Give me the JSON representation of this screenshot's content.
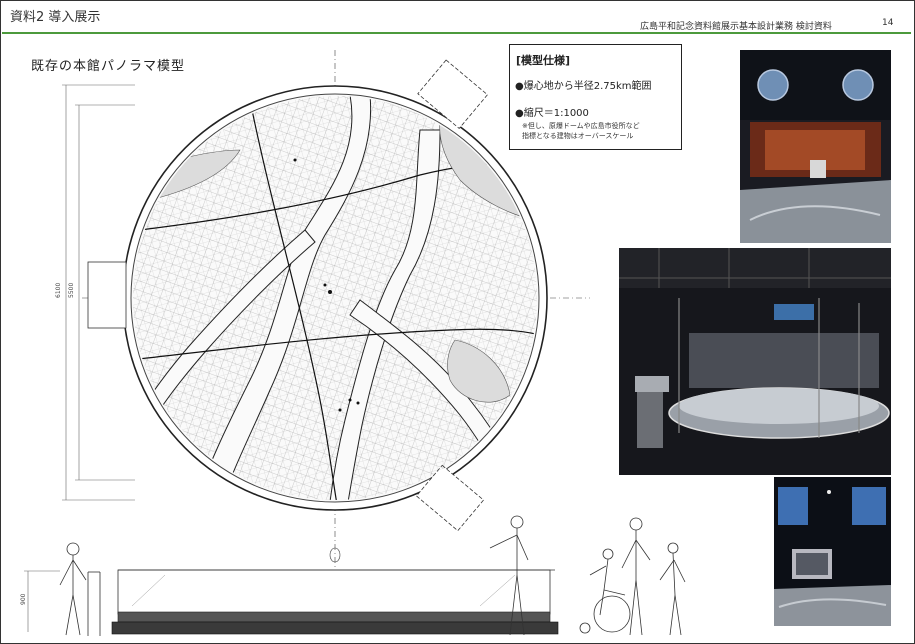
{
  "header": {
    "section": "資料2 導入展示",
    "project": "広島平和記念資料館展示基本設計業務 検討資料",
    "page_number": "14"
  },
  "title": "既存の本館パノラマ模型",
  "spec": {
    "title": "[模型仕様]",
    "item1": "●爆心地から半径2.75km範囲",
    "item2": "●縮尺＝1:1000",
    "note1": "※但し、原爆ドームや広島市役所など",
    "note2": "指標となる建物はオーバースケール"
  },
  "dimensions": {
    "outer": "6100",
    "inner": "5500",
    "height": "900"
  },
  "colors": {
    "accent_line": "#4c9a3c"
  }
}
